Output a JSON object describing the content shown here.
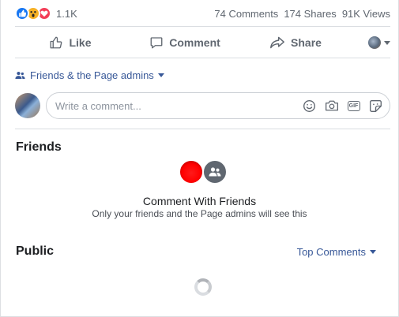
{
  "stats": {
    "reaction_count": "1.1K",
    "comments": "74 Comments",
    "shares": "174 Shares",
    "views": "91K Views"
  },
  "actions": {
    "like_label": "Like",
    "comment_label": "Comment",
    "share_label": "Share"
  },
  "audience": {
    "label": "Friends & the Page admins"
  },
  "composer": {
    "placeholder": "Write a comment...",
    "gif_label": "GIF"
  },
  "friends_section": {
    "title": "Friends",
    "heading": "Comment With Friends",
    "subtext": "Only your friends and the Page admins will see this"
  },
  "public_section": {
    "title": "Public",
    "sort_label": "Top Comments"
  },
  "colors": {
    "accent_link": "#385898",
    "like_blue": "#1877f2",
    "love_red": "#f33e58",
    "wow_yellow": "#f7b125",
    "muted_text": "#606770"
  },
  "icons": [
    "like-reaction-icon",
    "wow-reaction-icon",
    "love-reaction-icon",
    "thumbs-up-icon",
    "speech-bubble-icon",
    "share-arrow-icon",
    "people-icon",
    "smiley-icon",
    "camera-icon",
    "gif-icon",
    "sticker-icon",
    "loading-spinner-icon"
  ]
}
